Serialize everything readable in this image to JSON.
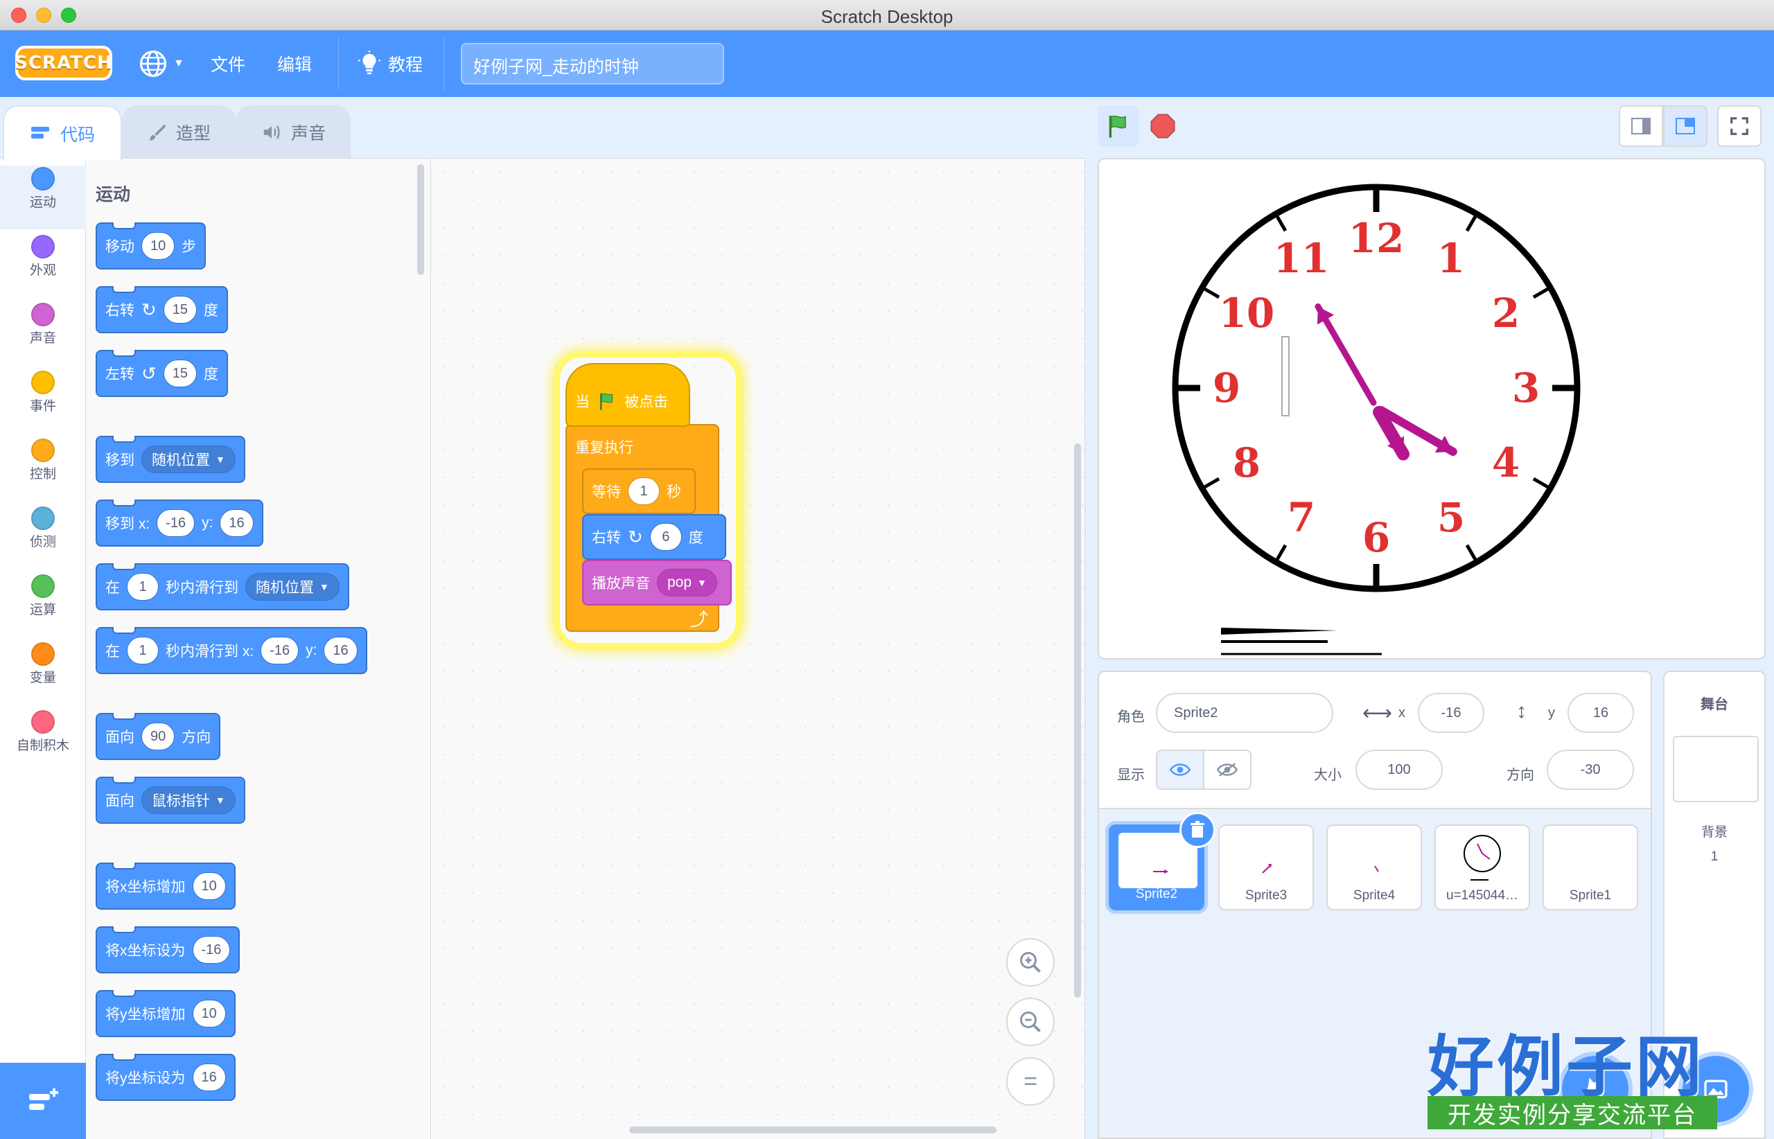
{
  "window": {
    "title": "Scratch Desktop"
  },
  "menubar": {
    "logo": "SCRATCH",
    "file": "文件",
    "edit": "编辑",
    "tutorials": "教程",
    "project_title": "好例子网_走动的时钟"
  },
  "tabs": [
    {
      "label": "代码"
    },
    {
      "label": "造型"
    },
    {
      "label": "声音"
    }
  ],
  "categories": [
    {
      "label": "运动",
      "color": "#4c97ff"
    },
    {
      "label": "外观",
      "color": "#9966ff"
    },
    {
      "label": "声音",
      "color": "#cf63cf"
    },
    {
      "label": "事件",
      "color": "#ffbf00"
    },
    {
      "label": "控制",
      "color": "#ffab19"
    },
    {
      "label": "侦测",
      "color": "#5cb1d6"
    },
    {
      "label": "运算",
      "color": "#59c059"
    },
    {
      "label": "变量",
      "color": "#ff8c1a"
    },
    {
      "label": "自制积木",
      "color": "#ff6680"
    }
  ],
  "palette": {
    "heading": "运动",
    "move": {
      "label": "移动",
      "steps": "10",
      "unit": "步"
    },
    "turn_right": {
      "label": "右转",
      "deg": "15",
      "unit": "度"
    },
    "turn_left": {
      "label": "左转",
      "deg": "15",
      "unit": "度"
    },
    "goto": {
      "label": "移到",
      "target": "随机位置"
    },
    "goto_xy": {
      "label": "移到 x:",
      "x": "-16",
      "ylabel": "y:",
      "y": "16"
    },
    "glide": {
      "prefix": "在",
      "secs": "1",
      "mid": "秒内滑行到",
      "target": "随机位置"
    },
    "glide_xy": {
      "prefix": "在",
      "secs": "1",
      "mid": "秒内滑行到 x:",
      "x": "-16",
      "ylabel": "y:",
      "y": "16"
    },
    "point_dir": {
      "label": "面向",
      "dir": "90",
      "unit": "方向"
    },
    "point_towards": {
      "label": "面向",
      "target": "鼠标指针"
    },
    "change_x": {
      "label": "将x坐标增加",
      "val": "10"
    },
    "set_x": {
      "label": "将x坐标设为",
      "val": "-16"
    },
    "change_y": {
      "label": "将y坐标增加",
      "val": "10"
    },
    "set_y": {
      "label": "将y坐标设为",
      "val": "16"
    }
  },
  "script": {
    "hat_when": "当",
    "hat_clicked": "被点击",
    "forever": "重复执行",
    "wait": "等待",
    "wait_secs": "1",
    "wait_unit": "秒",
    "turn": "右转",
    "turn_deg": "6",
    "turn_unit": "度",
    "play_sound": "播放声音",
    "sound": "pop"
  },
  "clock": {
    "numbers": [
      "12",
      "1",
      "2",
      "3",
      "4",
      "5",
      "6",
      "7",
      "8",
      "9",
      "10",
      "11"
    ],
    "hour_hand_angle_deg": 150,
    "minute_hand_angle_deg": 120,
    "long_hand_angle_deg": -30,
    "number_color": "#e03030",
    "hand_color": "#b5168f"
  },
  "sprite_info": {
    "sprite_label": "角色",
    "sprite_name": "Sprite2",
    "x_label": "x",
    "x": "-16",
    "y_label": "y",
    "y": "16",
    "show_label": "显示",
    "size_label": "大小",
    "size": "100",
    "direction_label": "方向",
    "direction": "-30"
  },
  "sprites": [
    {
      "name": "Sprite2"
    },
    {
      "name": "Sprite3"
    },
    {
      "name": "Sprite4"
    },
    {
      "name": "u=145044…"
    },
    {
      "name": "Sprite1"
    }
  ],
  "stage_selector": {
    "title": "舞台",
    "backdrop_label": "背景",
    "backdrop_count": "1"
  },
  "watermark": {
    "title": "好例子网",
    "subtitle": "开发实例分享交流平台"
  }
}
